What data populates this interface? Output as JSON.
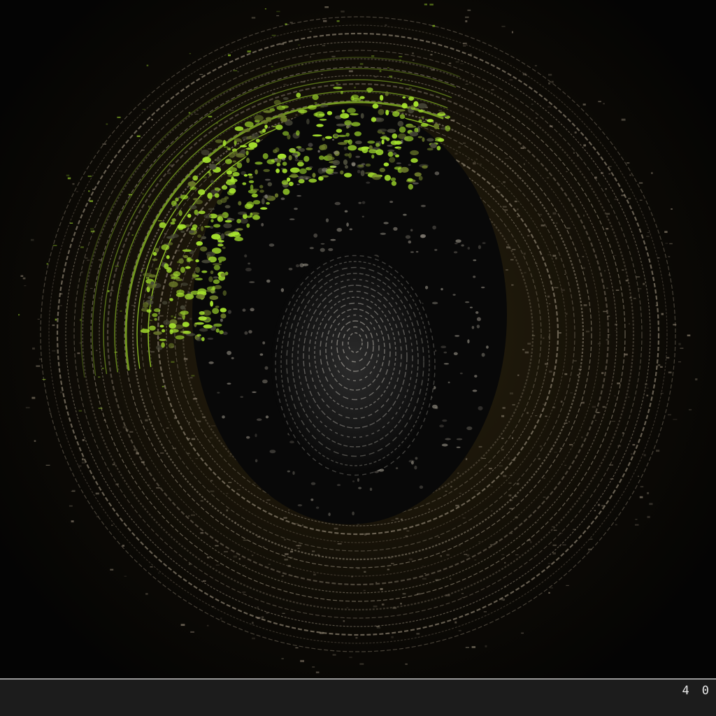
{
  "artwork": {
    "subject": "fingerprint-in-concentric-rings",
    "colors": {
      "background": "#050505",
      "ring": "#8c8170",
      "accent_green": "#a6e22e",
      "glow": "#2a2210",
      "print": "#3a3a3a"
    }
  },
  "bottom_bar": {
    "digit_left": "4",
    "digit_right": "0"
  }
}
